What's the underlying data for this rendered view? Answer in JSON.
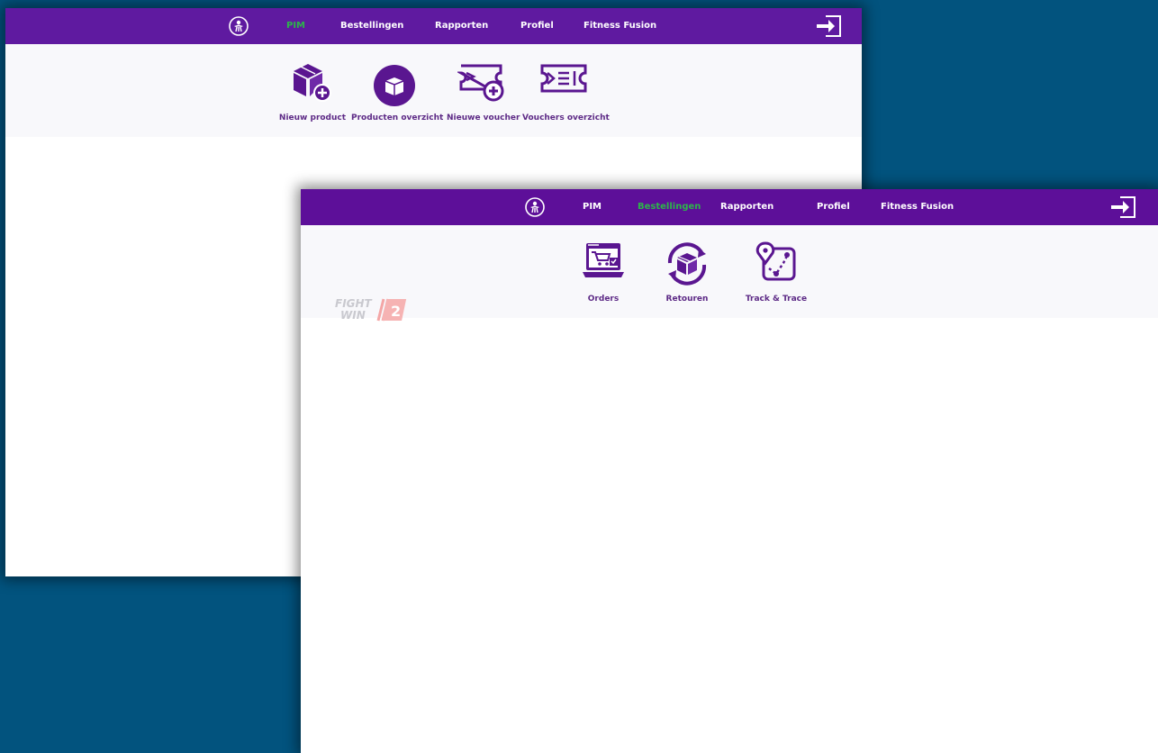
{
  "back_window": {
    "nav": {
      "items": [
        {
          "label": "PIM",
          "active": true
        },
        {
          "label": "Bestellingen",
          "active": false
        },
        {
          "label": "Rapporten",
          "active": false
        },
        {
          "label": "Profiel",
          "active": false
        },
        {
          "label": "Fitness Fusion",
          "active": false
        }
      ]
    },
    "tiles": [
      {
        "label": "Nieuw product",
        "icon": "new-product-icon"
      },
      {
        "label": "Producten overzicht",
        "icon": "products-overview-icon"
      },
      {
        "label": "Nieuwe voucher",
        "icon": "new-voucher-icon"
      },
      {
        "label": "Vouchers overzicht",
        "icon": "vouchers-overview-icon"
      }
    ]
  },
  "front_window": {
    "nav": {
      "items": [
        {
          "label": "PIM",
          "active": false
        },
        {
          "label": "Bestellingen",
          "active": true
        },
        {
          "label": "Rapporten",
          "active": false
        },
        {
          "label": "Profiel",
          "active": false
        },
        {
          "label": "Fitness Fusion",
          "active": false
        }
      ]
    },
    "brand_logo": {
      "line1": "FIGHT",
      "line2": "WIN",
      "mark": "2"
    },
    "tiles": [
      {
        "label": "Orders",
        "icon": "orders-icon"
      },
      {
        "label": "Retouren",
        "icon": "returns-icon"
      },
      {
        "label": "Track & Trace",
        "icon": "track-trace-icon"
      }
    ]
  },
  "colors": {
    "desktop": "#02537e",
    "nav_bg": "#5d0f99",
    "nav_active": "#2db44a",
    "icon": "#5a1690",
    "label": "#5d2a86",
    "subbar_bg": "#f8f8fb"
  }
}
